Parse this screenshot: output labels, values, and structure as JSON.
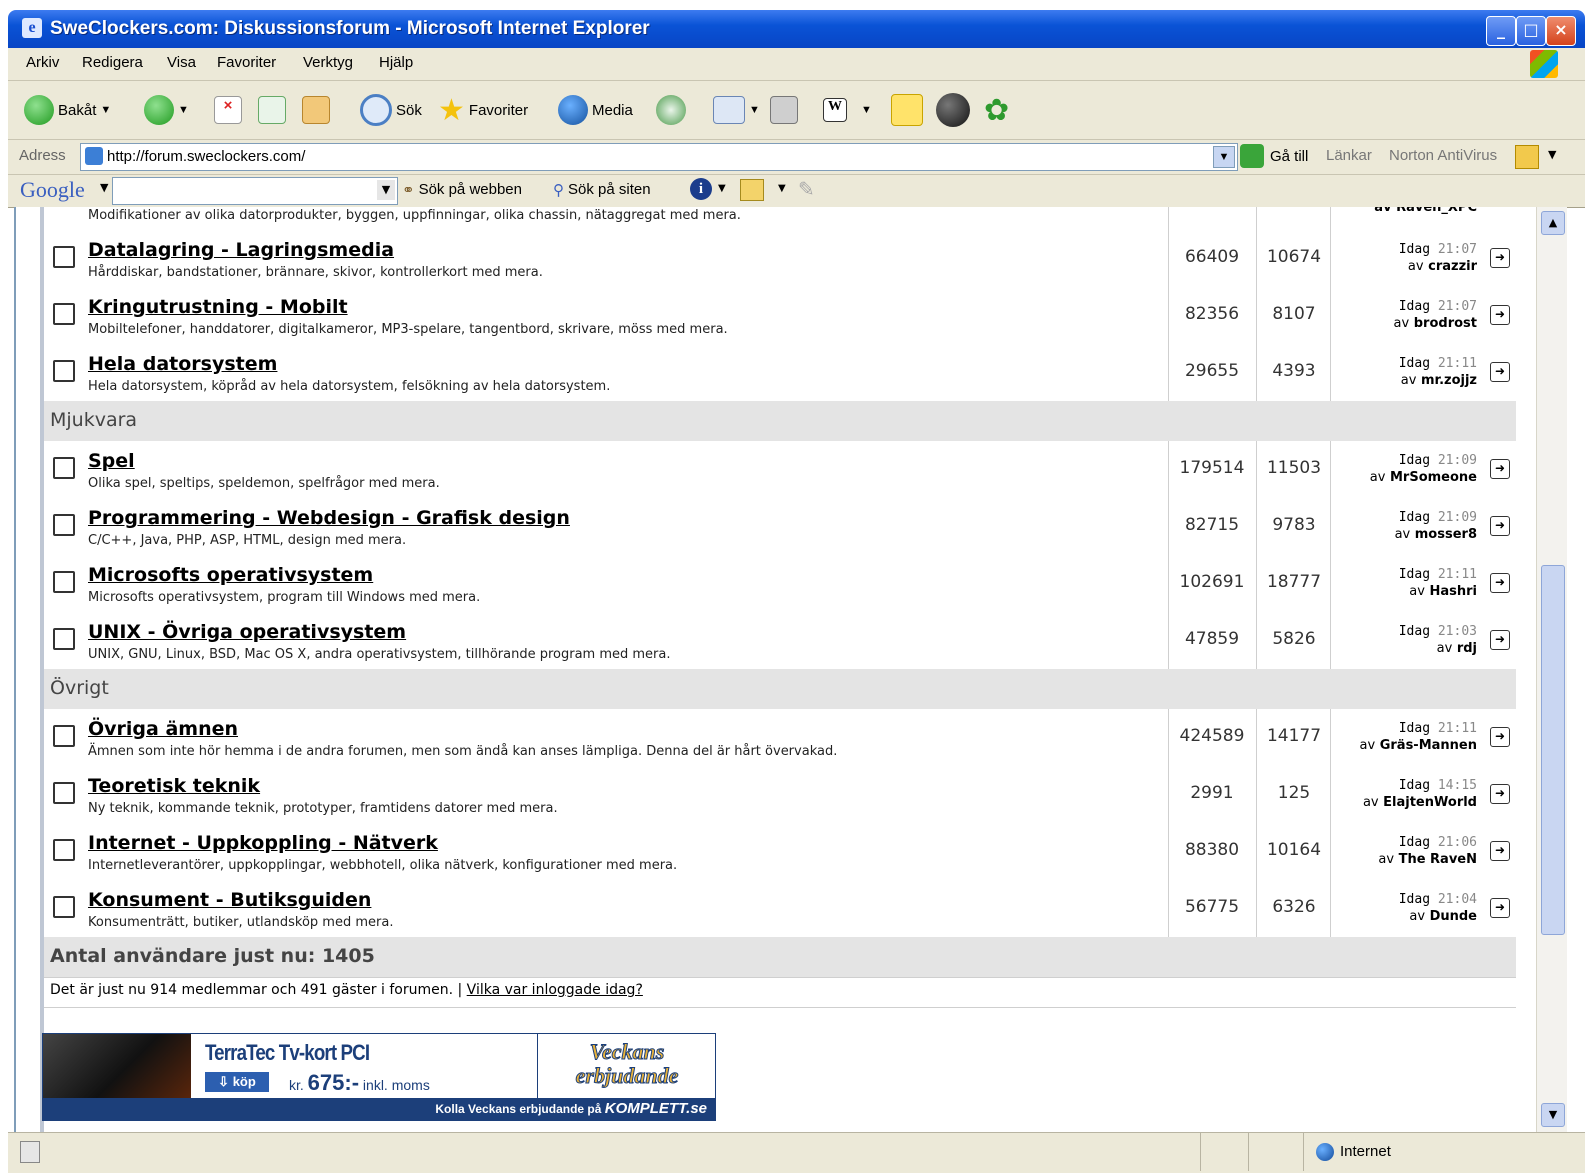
{
  "window": {
    "title": "SweClockers.com: Diskussionsforum - Microsoft Internet Explorer",
    "buttons": [
      "_",
      "□",
      "×"
    ]
  },
  "menu": [
    "Arkiv",
    "Redigera",
    "Visa",
    "Favoriter",
    "Verktyg",
    "Hjälp"
  ],
  "toolbar": {
    "back": "Bakåt",
    "search": "Sök",
    "favorites": "Favoriter",
    "media": "Media"
  },
  "address": {
    "label": "Adress",
    "url": "http://forum.sweclockers.com/",
    "go": "Gå till",
    "links": "Länkar",
    "norton": "Norton AntiVirus"
  },
  "google": {
    "logo": "Google",
    "search_web": "Sök på webben",
    "search_site": "Sök på siten"
  },
  "top_partial": {
    "desc": "Modifikationer av olika datorprodukter, byggen, uppfinningar, olika chassin, nätaggregat med mera.",
    "by": "av Raven_XPC"
  },
  "sections": [
    {
      "name": "",
      "forums": [
        {
          "title": "Datalagring - Lagringsmedia",
          "desc": "Hårddiskar, bandstationer, brännare, skivor, kontrollerkort med mera.",
          "posts": "66409",
          "topics": "10674",
          "time_day": "Idag",
          "time": "21:07",
          "av": "av",
          "by": "crazzir"
        },
        {
          "title": "Kringutrustning - Mobilt",
          "desc": "Mobiltelefoner, handdatorer, digitalkameror, MP3-spelare, tangentbord, skrivare, möss med mera.",
          "posts": "82356",
          "topics": "8107",
          "time_day": "Idag",
          "time": "21:07",
          "av": "av",
          "by": "brodrost"
        },
        {
          "title": "Hela datorsystem",
          "desc": "Hela datorsystem, köpråd av hela datorsystem, felsökning av hela datorsystem.",
          "posts": "29655",
          "topics": "4393",
          "time_day": "Idag",
          "time": "21:11",
          "av": "av",
          "by": "mr.zojjz"
        }
      ]
    },
    {
      "name": "Mjukvara",
      "forums": [
        {
          "title": "Spel",
          "desc": "Olika spel, speltips, speldemon, spelfrågor med mera.",
          "posts": "179514",
          "topics": "11503",
          "time_day": "Idag",
          "time": "21:09",
          "av": "av",
          "by": "MrSomeone"
        },
        {
          "title": "Programmering - Webdesign - Grafisk design",
          "desc": "C/C++, Java, PHP, ASP, HTML, design med mera.",
          "posts": "82715",
          "topics": "9783",
          "time_day": "Idag",
          "time": "21:09",
          "av": "av",
          "by": "mosser8"
        },
        {
          "title": "Microsofts operativsystem",
          "desc": "Microsofts operativsystem, program till Windows med mera.",
          "posts": "102691",
          "topics": "18777",
          "time_day": "Idag",
          "time": "21:11",
          "av": "av",
          "by": "Hashri"
        },
        {
          "title": "UNIX - Övriga operativsystem",
          "desc": "UNIX, GNU, Linux, BSD, Mac OS X, andra operativsystem, tillhörande program med mera.",
          "posts": "47859",
          "topics": "5826",
          "time_day": "Idag",
          "time": "21:03",
          "av": "av",
          "by": "rdj"
        }
      ]
    },
    {
      "name": "Övrigt",
      "forums": [
        {
          "title": "Övriga ämnen",
          "desc": "Ämnen som inte hör hemma i de andra forumen, men som ändå kan anses lämpliga. Denna del är hårt övervakad.",
          "posts": "424589",
          "topics": "14177",
          "time_day": "Idag",
          "time": "21:11",
          "av": "av",
          "by": "Gräs-Mannen"
        },
        {
          "title": "Teoretisk teknik",
          "desc": "Ny teknik, kommande teknik, prototyper, framtidens datorer med mera.",
          "posts": "2991",
          "topics": "125",
          "time_day": "Idag",
          "time": "14:15",
          "av": "av",
          "by": "ElajtenWorld"
        },
        {
          "title": "Internet - Uppkoppling - Nätverk",
          "desc": "Internetleverantörer, uppkopplingar, webbhotell, olika nätverk, konfigurationer med mera.",
          "posts": "88380",
          "topics": "10164",
          "time_day": "Idag",
          "time": "21:06",
          "av": "av",
          "by": "The RaveN"
        },
        {
          "title": "Konsument - Butiksguiden",
          "desc": "Konsumenträtt, butiker, utlandsköp med mera.",
          "posts": "56775",
          "topics": "6326",
          "time_day": "Idag",
          "time": "21:04",
          "av": "av",
          "by": "Dunde"
        }
      ]
    }
  ],
  "users": {
    "heading": "Antal användare just nu: 1405",
    "line": "Det är just nu 914 medlemmar och 491 gäster i forumen.",
    "sep": "|",
    "link": "Vilka var inloggade idag?"
  },
  "ad": {
    "product": "TerraTec Tv-kort PCI",
    "buy": "köp",
    "price_prefix": "kr.",
    "price": "675:-",
    "price_suffix": "inkl. moms",
    "footer_text": "Kolla Veckans erbjudande på",
    "footer_brand": "KOMPLETT.se",
    "badge1": "Veckans",
    "badge2": "erbjudande"
  },
  "status": {
    "zone": "Internet"
  }
}
